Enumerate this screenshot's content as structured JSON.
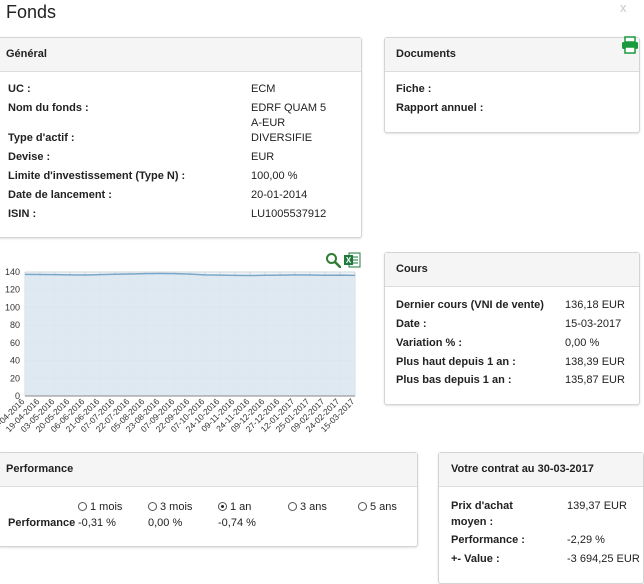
{
  "title": "Fonds",
  "close": "x",
  "general": {
    "header": "Général",
    "rows": [
      {
        "label": "UC :",
        "value": "ECM"
      },
      {
        "label": "Nom du fonds :",
        "value": "EDRF QUAM 5"
      },
      {
        "label": "",
        "value": "A-EUR"
      },
      {
        "label": "Type d'actif :",
        "value": "DIVERSIFIE"
      },
      {
        "label": "Devise :",
        "value": "EUR"
      },
      {
        "label": "Limite d'investissement (Type N) :",
        "value": "100,00 %"
      },
      {
        "label": "Date de lancement :",
        "value": "20-01-2014"
      },
      {
        "label": "ISIN :",
        "value": "LU1005537912"
      }
    ]
  },
  "documents": {
    "header": "Documents",
    "rows": [
      "Fiche :",
      "Rapport annuel :"
    ]
  },
  "cours": {
    "header": "Cours",
    "rows": [
      {
        "label": "Dernier cours (VNI de vente)",
        "value": "136,18 EUR"
      },
      {
        "label": "Date :",
        "value": "15-03-2017"
      },
      {
        "label": "Variation % :",
        "value": "0,00 %"
      },
      {
        "label": "Plus haut depuis 1 an :",
        "value": "138,39 EUR"
      },
      {
        "label": "Plus bas depuis 1 an :",
        "value": "135,87 EUR"
      }
    ]
  },
  "performance": {
    "header": "Performance",
    "row_label": "Performance",
    "periods": [
      {
        "label": "1 mois",
        "value": "-0,31 %",
        "selected": false
      },
      {
        "label": "3 mois",
        "value": "0,00 %",
        "selected": false
      },
      {
        "label": "1 an",
        "value": "-0,74 %",
        "selected": true
      },
      {
        "label": "3 ans",
        "value": "",
        "selected": false
      },
      {
        "label": "5 ans",
        "value": "",
        "selected": false
      }
    ]
  },
  "contrat": {
    "header": "Votre contrat au 30-03-2017",
    "rows": [
      {
        "label": "Prix d'achat",
        "value": "139,37 EUR"
      },
      {
        "label": "moyen :",
        "value": ""
      },
      {
        "label": "Performance :",
        "value": "-2,29 %"
      },
      {
        "label": "+- Value :",
        "value": "-3 694,25 EUR"
      }
    ]
  },
  "icons": {
    "print": "printer-icon",
    "search": "search-icon",
    "excel": "excel-icon"
  },
  "colors": {
    "print": "#1a9a3c",
    "search": "#2e7d32",
    "excel": "#1d7a3a",
    "line": "#7aa6c8",
    "area": "#dde8f0"
  },
  "chart_data": {
    "type": "area",
    "title": "",
    "xlabel": "",
    "ylabel": "",
    "ylim": [
      0,
      140
    ],
    "yticks": [
      0,
      20,
      40,
      60,
      80,
      100,
      120,
      140
    ],
    "grid": true,
    "x": [
      "04-04-2016",
      "19-04-2016",
      "03-05-2016",
      "20-05-2016",
      "06-06-2016",
      "21-06-2016",
      "07-07-2016",
      "22-07-2016",
      "05-08-2016",
      "23-08-2016",
      "07-09-2016",
      "22-09-2016",
      "07-10-2016",
      "24-10-2016",
      "09-11-2016",
      "24-11-2016",
      "09-12-2016",
      "27-12-2016",
      "12-01-2017",
      "25-01-2017",
      "09-02-2017",
      "24-02-2017",
      "15-03-2017"
    ],
    "values": [
      137.3,
      137.2,
      137.0,
      136.8,
      136.6,
      137.0,
      137.5,
      137.8,
      138.1,
      138.3,
      138.2,
      137.6,
      136.8,
      136.5,
      136.2,
      136.0,
      136.3,
      136.5,
      136.7,
      136.6,
      136.4,
      136.5,
      136.2
    ]
  }
}
